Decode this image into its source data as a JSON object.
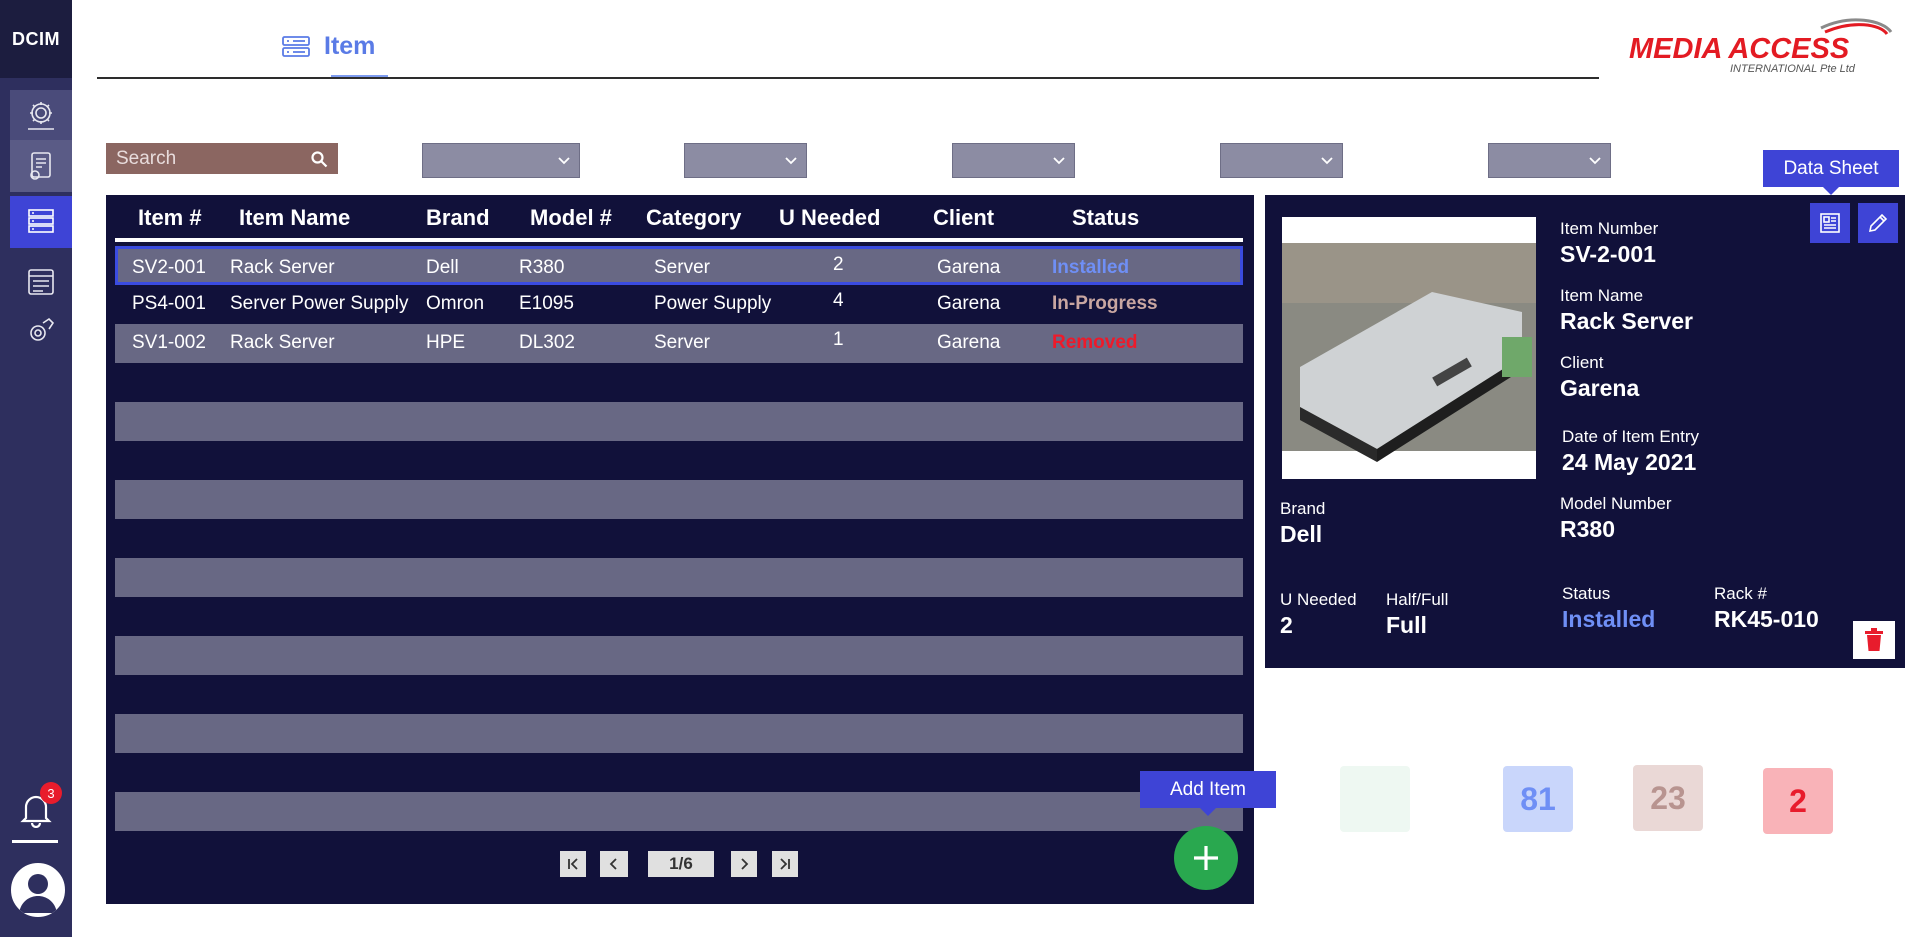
{
  "app": {
    "brand": "DCIM",
    "notification_count": "3"
  },
  "header": {
    "title": "Item",
    "logo_line1": "MEDIA ACCESS",
    "logo_line2": "INTERNATIONAL Pte Ltd"
  },
  "search": {
    "placeholder": "Search"
  },
  "table": {
    "columns": [
      "Item #",
      "Item Name",
      "Brand",
      "Model #",
      "Category",
      "U Needed",
      "Client",
      "Status"
    ],
    "rows": [
      {
        "item_no": "SV2-001",
        "name": "Rack Server",
        "brand": "Dell",
        "model": "R380",
        "category": "Server",
        "u_needed": "2",
        "client": "Garena",
        "status": "Installed"
      },
      {
        "item_no": "PS4-001",
        "name": "Server Power Supply",
        "brand": "Omron",
        "model": "E1095",
        "category": "Power Supply",
        "u_needed": "4",
        "client": "Garena",
        "status": "In-Progress"
      },
      {
        "item_no": "SV1-002",
        "name": "Rack Server",
        "brand": "HPE",
        "model": "DL302",
        "category": "Server",
        "u_needed": "1",
        "client": "Garena",
        "status": "Removed"
      }
    ],
    "page": "1/6"
  },
  "add_item": {
    "tooltip": "Add Item"
  },
  "detail": {
    "data_sheet_tooltip": "Data Sheet",
    "item_number_label": "Item Number",
    "item_number": "SV-2-001",
    "item_name_label": "Item Name",
    "item_name": "Rack Server",
    "client_label": "Client",
    "client": "Garena",
    "date_label": "Date of Item Entry",
    "date": "24 May 2021",
    "brand_label": "Brand",
    "brand": "Dell",
    "model_label": "Model Number",
    "model": "R380",
    "u_needed_label": "U Needed",
    "u_needed": "2",
    "half_full_label": "Half/Full",
    "half_full": "Full",
    "status_label": "Status",
    "status": "Installed",
    "rack_label": "Rack #",
    "rack": "RK45-010"
  },
  "counters": [
    {
      "value": "",
      "color": "#eef8f2",
      "text": "#d7ecdf"
    },
    {
      "value": "81",
      "color": "#c9d6fb",
      "text": "#6f8ff5"
    },
    {
      "value": "23",
      "color": "#ead8d6",
      "text": "#b89490"
    },
    {
      "value": "2",
      "color": "#f9b3b8",
      "text": "#e81c2c"
    }
  ],
  "colors": {
    "accent": "#3e44d6",
    "sidebar": "#2e2f5e",
    "panel": "#11113a",
    "installed": "#6f8ff5",
    "in_progress": "#c9a6a1",
    "removed": "#ee1a2a",
    "add": "#29a84f"
  }
}
